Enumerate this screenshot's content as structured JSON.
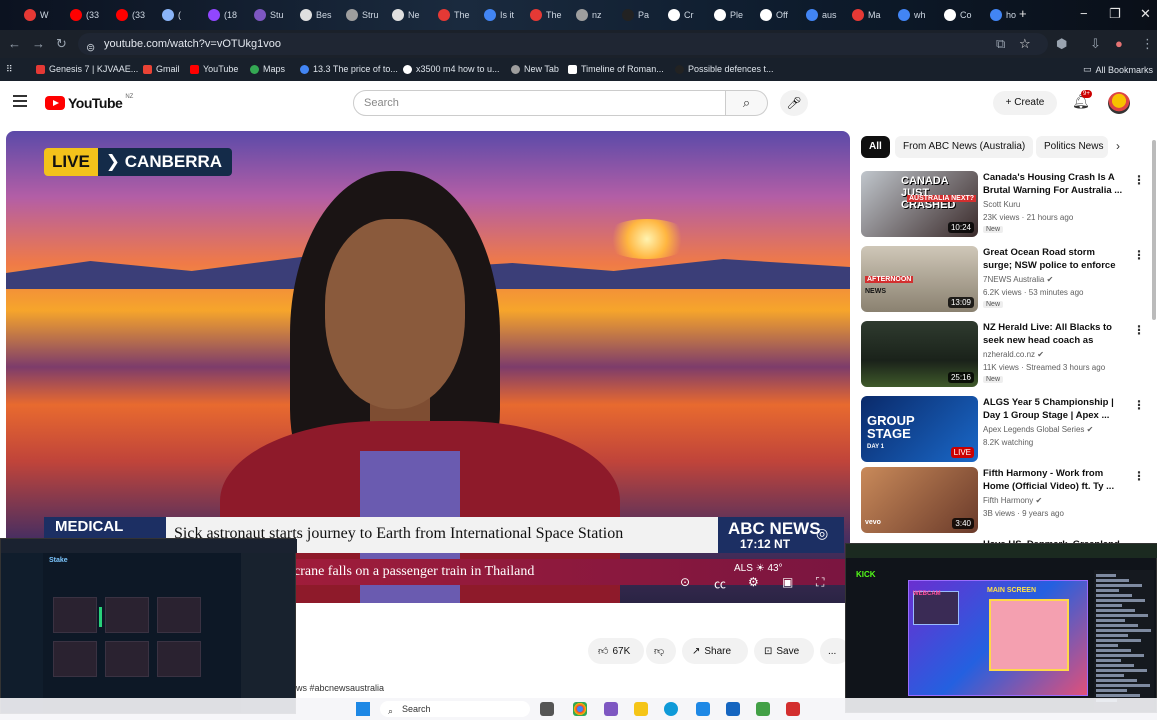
{
  "browser": {
    "tabs": [
      {
        "label": "W",
        "color": "#e53935"
      },
      {
        "label": "(33",
        "color": "#ff0000"
      },
      {
        "label": "(33",
        "color": "#ff0000"
      },
      {
        "label": "(",
        "color": "#8ab4f8"
      },
      {
        "label": "(18",
        "color": "#9146ff"
      },
      {
        "label": "Stu",
        "color": "#7e57c2"
      },
      {
        "label": "Bes",
        "color": "#e0e0e0"
      },
      {
        "label": "Stru",
        "color": "#9e9e9e"
      },
      {
        "label": "Ne",
        "color": "#e0e0e0"
      },
      {
        "label": "The",
        "color": "#e53935"
      },
      {
        "label": "Is it",
        "color": "#4285f4"
      },
      {
        "label": "The",
        "color": "#e53935"
      },
      {
        "label": "nz",
        "color": "#9e9e9e"
      },
      {
        "label": "Pa",
        "color": "#222"
      },
      {
        "label": "Cr",
        "color": "#fff"
      },
      {
        "label": "Ple",
        "color": "#fff"
      },
      {
        "label": "Off",
        "color": "#fff"
      },
      {
        "label": "aus",
        "color": "#4285f4"
      },
      {
        "label": "Ma",
        "color": "#e53935"
      },
      {
        "label": "wh",
        "color": "#4285f4"
      },
      {
        "label": "Co",
        "color": "#fff"
      },
      {
        "label": "ho",
        "color": "#4285f4"
      }
    ],
    "url": "youtube.com/watch?v=vOTUkg1voo",
    "bookmarks": [
      "Genesis 7 | KJVAAE...",
      "Gmail",
      "YouTube",
      "Maps",
      "13.3 The price of to...",
      "x3500 m4 how to u...",
      "New Tab",
      "Timeline of Roman...",
      "Possible defences t..."
    ],
    "all_bookmarks": "All Bookmarks"
  },
  "youtube": {
    "logo_text": "YouTube",
    "country": "NZ",
    "search_placeholder": "Search",
    "create_label": "Create",
    "notif_badge": "9+"
  },
  "video": {
    "live_label": "LIVE",
    "location": "CANBERRA",
    "tag": "MEDICAL",
    "headline": "Sick astronaut starts journey to Earth from International Space Station",
    "network": "ABC NEWS",
    "time": "17:12 NT",
    "lower_ticker": "crane falls on a passenger train in Thailand",
    "weather_label": "ALS",
    "temperature": "43°"
  },
  "actions": {
    "likes": "67K",
    "share": "Share",
    "save": "Save",
    "more": "..."
  },
  "hashtags": "ws #abcnewsaustralia",
  "chips": [
    "All",
    "From ABC News (Australia)",
    "Politics News"
  ],
  "recommendations": [
    {
      "title": "Canada's Housing Crash Is A Brutal Warning For Australia ...",
      "channel": "Scott Kuru",
      "meta": "23K views · 21 hours ago",
      "badge": "New",
      "duration": "10:24",
      "thumb_text": "CANADA JUST CRASHED",
      "thumb_sub": "AUSTRALIA NEXT?"
    },
    {
      "title": "Great Ocean Road storm surge; NSW police to enforce protest ...",
      "channel": "7NEWS Australia",
      "meta": "6.2K views · 53 minutes ago",
      "badge": "New",
      "duration": "13:09",
      "thumb_text": "AFTERNOON",
      "thumb_sub": "NEWS"
    },
    {
      "title": "NZ Herald Live: All Blacks to seek new head coach as Scott...",
      "channel": "nzherald.co.nz",
      "meta": "11K views · Streamed 3 hours ago",
      "badge": "New",
      "duration": "25:16",
      "thumb_text": "",
      "thumb_sub": ""
    },
    {
      "title": "ALGS Year 5 Championship | Day 1 Group Stage | Apex ...",
      "channel": "Apex Legends Global Series",
      "meta": "8.2K watching",
      "badge": "",
      "duration": "LIVE",
      "thumb_text": "GROUP STAGE",
      "thumb_sub": "DAY 1"
    },
    {
      "title": "Fifth Harmony - Work from Home (Official Video) ft. Ty ...",
      "channel": "Fifth Harmony",
      "meta": "3B views · 9 years ago",
      "badge": "",
      "duration": "3:40",
      "thumb_text": "vevo",
      "thumb_sub": ""
    },
    {
      "title": "Have US, Denmark, Greenland",
      "channel": "",
      "meta": "",
      "badge": "",
      "duration": "",
      "thumb_text": "",
      "thumb_sub": ""
    }
  ],
  "overlay_left": {
    "brand": "Stake"
  },
  "overlay_right": {
    "brand": "KICK",
    "stream_title": "MAIN SCREEN",
    "webcam_label": "WEBCAM"
  },
  "taskbar": {
    "search_label": "Search"
  }
}
